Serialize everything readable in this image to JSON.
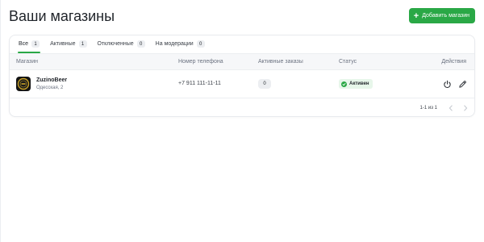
{
  "header": {
    "title": "Ваши магазины",
    "add_button_label": "Добавить магазин"
  },
  "tabs": [
    {
      "label": "Все",
      "count": "1",
      "active": true
    },
    {
      "label": "Активные",
      "count": "1",
      "active": false
    },
    {
      "label": "Отключенные",
      "count": "0",
      "active": false
    },
    {
      "label": "На модерации",
      "count": "0",
      "active": false
    }
  ],
  "table": {
    "columns": [
      "Магазин",
      "Номер телефона",
      "Активные заказы",
      "Статус",
      "Действия"
    ],
    "rows": [
      {
        "name": "ZuzinoBeer",
        "address": "Одесская, 2",
        "phone": "+7 911 111-11-11",
        "active_orders": "0",
        "status": "Активен"
      }
    ]
  },
  "pagination": {
    "range_text": "1-1 из 1"
  },
  "colors": {
    "accent": "#2aa846",
    "status_bg": "#e7f6ea"
  },
  "icons": {
    "add": "plus-icon",
    "status": "check-circle-icon",
    "power": "power-icon",
    "edit": "pencil-icon",
    "prev": "chevron-left-icon",
    "next": "chevron-right-icon"
  }
}
